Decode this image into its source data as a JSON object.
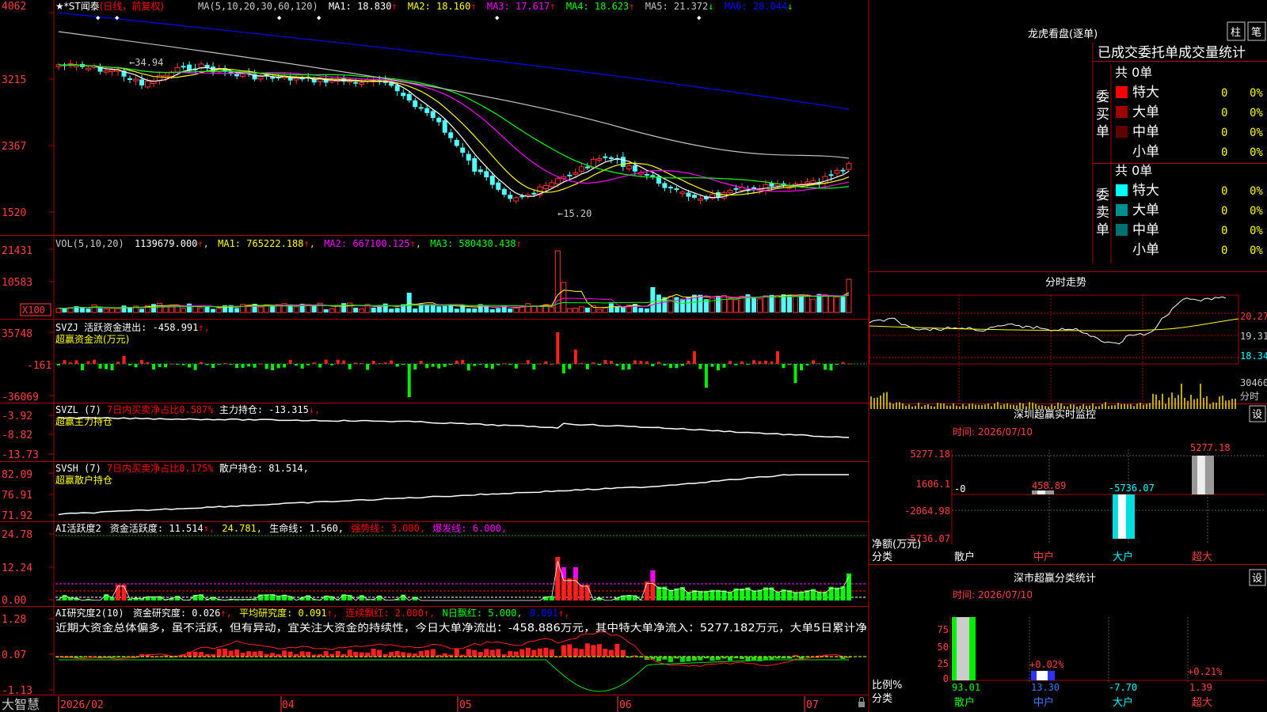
{
  "stock": {
    "star": "★",
    "name": "*ST闻泰",
    "period": "(日线，前复权)"
  },
  "ma": {
    "label": "MA(5,10,20,30,60,120)",
    "items": [
      {
        "t": "MA1: 18.830",
        "arrow": "↑",
        "color": "#ffffff"
      },
      {
        "t": "MA2: 18.160",
        "arrow": "↑",
        "color": "#ffff00"
      },
      {
        "t": "MA3: 17.617",
        "arrow": "↑",
        "color": "#ff00ff"
      },
      {
        "t": "MA4: 18.623",
        "arrow": "↑",
        "color": "#00ff00"
      },
      {
        "t": "MA5: 21.372",
        "arrow": "↓",
        "color": "#c0c0c0"
      },
      {
        "t": "MA6: 28.044",
        "arrow": "↓",
        "color": "#0000ff"
      }
    ]
  },
  "price_axis": [
    "4062",
    "3215",
    "2367",
    "1520"
  ],
  "price_marks": {
    "high": "←34.94",
    "low": "←15.20"
  },
  "vol": {
    "label": "VOL(5,10,20)",
    "items": [
      {
        "t": "1139679.000",
        "arrow": "↑",
        "color": "#ffffff"
      },
      {
        "t": "MA1: 765222.188",
        "arrow": "↑",
        "color": "#ffff00"
      },
      {
        "t": "MA2: 667100.125",
        "arrow": "↑",
        "color": "#ff00ff"
      },
      {
        "t": "MA3: 580430.438",
        "arrow": "↑",
        "color": "#00ff00"
      }
    ],
    "axis": [
      "21431",
      "10583",
      "X100"
    ]
  },
  "svzj": {
    "title": "SVZJ  活跃资金进出: -458.991",
    "arrow": "↑,",
    "sub": "超赢资金流(万元)",
    "axis": [
      "35748",
      "-161",
      "-36069"
    ]
  },
  "svzl": {
    "title_a": "SVZL (7)",
    "title_b": "7日内买卖净占比0.587%",
    "title_c": "主力持仓: -13.315",
    "arrow": "↓,",
    "sub": "超赢主力持仓",
    "axis": [
      "-3.92",
      "-8.82",
      "-13.73"
    ]
  },
  "svsh": {
    "title_a": "SVSH (7)",
    "title_b": "7日内买卖净占比0.175%",
    "title_c": "散户持仓: 81.514,",
    "sub": "超赢散户持仓",
    "axis": [
      "82.09",
      "76.91",
      "71.92"
    ]
  },
  "ai_active": {
    "title": "AI活跃度2",
    "items": [
      {
        "t": "资金活跃度: 11.514",
        "color": "#ffffff"
      },
      {
        "t": "↑,",
        "color": "#ff0000"
      },
      {
        "t": "24.781,",
        "color": "#ffff00"
      },
      {
        "t": "生命线: 1.560,",
        "color": "#ffffff"
      },
      {
        "t": "强势线: 3.000,",
        "color": "#ff0000"
      },
      {
        "t": "爆发线: 6.000,",
        "color": "#ff00ff"
      }
    ],
    "axis": [
      "24.78",
      "12.24",
      "0.00"
    ]
  },
  "ai_research": {
    "title": "AI研究度2(10)",
    "items": [
      {
        "t": "资金研究度: 0.026",
        "color": "#ffffff"
      },
      {
        "t": "↑,",
        "color": "#ff0000"
      },
      {
        "t": "平均研究度: 0.091",
        "color": "#ffff00"
      },
      {
        "t": "↑,",
        "color": "#ff0000"
      },
      {
        "t": "连续飘红: 2.000",
        "color": "#ff0000"
      },
      {
        "t": "↑,",
        "color": "#ff0000"
      },
      {
        "t": "N日飘红: 5.000,",
        "color": "#00ff00"
      },
      {
        "t": "0.091",
        "color": "#0000ff"
      },
      {
        "t": "↑,",
        "color": "#ff0000"
      }
    ],
    "comment": "近期大资金总体偏多，虽不活跃，但有异动，宜关注大资金的持续性，今日大单净流出：-458.886万元，其中特大单净流入：5277.182万元，大单5日累计净",
    "axis": [
      "1.28",
      "0.07",
      "-1.13"
    ]
  },
  "dates": [
    "2026/02",
    "04",
    "05",
    "06",
    "07"
  ],
  "brand": "大智慧",
  "lhkp": {
    "title": "龙虎看盘(逐单)",
    "btn1": "柱",
    "btn2": "笔",
    "tab_title": "已成交委托单成交量统计",
    "buy": {
      "label": "委买单",
      "count": "共 0单",
      "rows": [
        {
          "name": "特大",
          "val": "0",
          "pct": "0%",
          "color": "#ff0000"
        },
        {
          "name": "大单",
          "val": "0",
          "pct": "0%",
          "color": "#a00000"
        },
        {
          "name": "中单",
          "val": "0",
          "pct": "0%",
          "color": "#600000"
        },
        {
          "name": "小单",
          "val": "0",
          "pct": "0%",
          "color": ""
        }
      ]
    },
    "sell": {
      "label": "委卖单",
      "count": "共 0单",
      "rows": [
        {
          "name": "特大",
          "val": "0",
          "pct": "0%",
          "color": "#00ffff"
        },
        {
          "name": "大单",
          "val": "0",
          "pct": "0%",
          "color": "#009090"
        },
        {
          "name": "中单",
          "val": "0",
          "pct": "0%",
          "color": "#007070"
        },
        {
          "name": "小单",
          "val": "0",
          "pct": "0%",
          "color": ""
        }
      ]
    }
  },
  "fsz": {
    "title": "分时走势",
    "axis": [
      "20.27",
      "19.31",
      "18.34",
      "30460"
    ],
    "unit": "分时"
  },
  "szcy": {
    "title": "深圳超赢实时监控",
    "btn": "设",
    "time": "时间: 2026/07/10",
    "axis": [
      "5277.18",
      "1606.1",
      "-2064.98",
      "-5736.07"
    ],
    "y_title": "净额(万元)",
    "x_title": "分类",
    "vals": [
      "-0",
      "458.89",
      "-5736.07",
      "5277.18"
    ],
    "cats": [
      "散户",
      "中户",
      "大户",
      "超大"
    ]
  },
  "sscy": {
    "title": "深市超赢分类统计",
    "btn": "设",
    "time": "时间: 2026/07/10",
    "axis": [
      "75",
      "50",
      "25",
      "0"
    ],
    "y_title": "比例%",
    "x_title": "分类",
    "top_labels": [
      "+0.02%",
      "+0.21%"
    ],
    "vals": [
      "93.01",
      "13.30",
      "-7.70",
      "1.39"
    ],
    "cats": [
      "散户",
      "中户",
      "大户",
      "超大"
    ]
  }
}
